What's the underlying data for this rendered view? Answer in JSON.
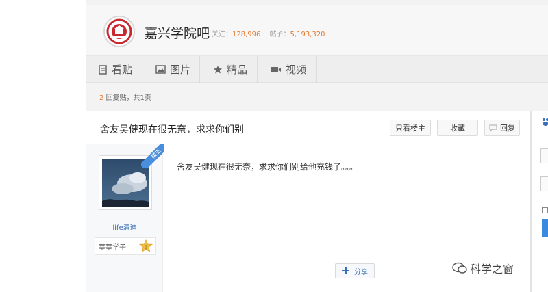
{
  "forum": {
    "name": "嘉兴学院吧",
    "follow_label": "关注：",
    "follow_count": "128,996",
    "posts_label": "帖子：",
    "posts_count": "5,193,320"
  },
  "tabs": [
    {
      "label": "看贴",
      "icon": "document-icon"
    },
    {
      "label": "图片",
      "icon": "image-icon"
    },
    {
      "label": "精品",
      "icon": "star-icon"
    },
    {
      "label": "视频",
      "icon": "video-icon"
    }
  ],
  "reply_info": {
    "count": "2",
    "text": "回复贴，共1页"
  },
  "thread": {
    "title": "舍友吴健现在很无奈，求求你们别",
    "only_op_label": "只看楼主",
    "favorite_label": "收藏",
    "reply_label": "回复"
  },
  "post": {
    "ribbon": "楼主",
    "author_name": "life清迪",
    "level_title": "莘莘学子",
    "level_number": "1",
    "content": "舍友吴健现在很无奈，求求你们别给他充钱了。。。",
    "share_label": "分享"
  },
  "watermark": {
    "text": "科学之窗"
  },
  "colors": {
    "accent_orange": "#e57b2f",
    "link_blue": "#3a6fb7",
    "ribbon_blue": "#4a8fdd"
  }
}
